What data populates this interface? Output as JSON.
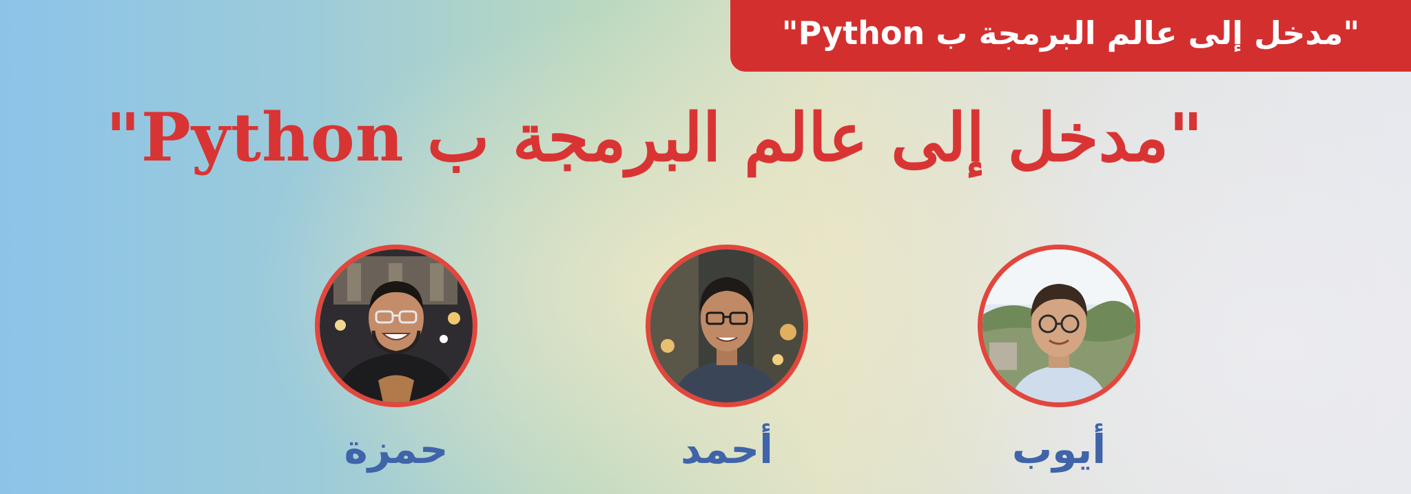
{
  "banner": {
    "tag_text": "\"مدخل إلى عالم البرمجة ب Python\"",
    "title": "\"مدخل إلى عالم البرمجة ب Python\""
  },
  "speakers": [
    {
      "name": "أيوب"
    },
    {
      "name": "أحمد"
    },
    {
      "name": "حمزة"
    }
  ],
  "colors": {
    "accent_red": "#d42f2f",
    "name_blue": "#3f64aa",
    "ring_red": "#e2463c"
  }
}
